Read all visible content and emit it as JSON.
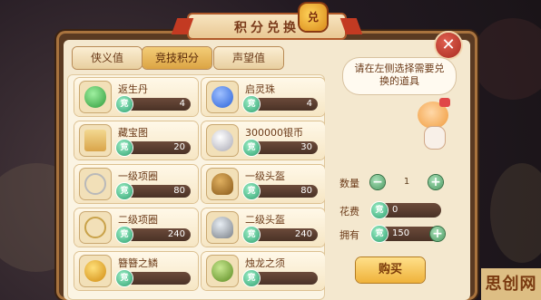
{
  "title": "积分兑换",
  "banner_badge": "兑",
  "close_glyph": "✕",
  "tabs": [
    {
      "label": "侠义值",
      "active": false
    },
    {
      "label": "竞技积分",
      "active": true
    },
    {
      "label": "声望值",
      "active": false
    }
  ],
  "currency_glyph": "竞",
  "items": [
    {
      "name": "返生丹",
      "price": "4",
      "icon": "pill-icon",
      "color": "#2e9a3a"
    },
    {
      "name": "启灵珠",
      "price": "4",
      "icon": "blue-orb-icon",
      "color": "#2a62d8"
    },
    {
      "name": "藏宝图",
      "price": "20",
      "icon": "treasure-map-icon",
      "color": "#d9a54a"
    },
    {
      "name": "300000银币",
      "price": "30",
      "icon": "silver-coins-icon",
      "color": "#c8c8d0"
    },
    {
      "name": "一级项圈",
      "price": "80",
      "icon": "necklace-icon",
      "color": "#b9b9b9"
    },
    {
      "name": "一级头盔",
      "price": "80",
      "icon": "helmet-icon",
      "color": "#b07a2a"
    },
    {
      "name": "二级项圈",
      "price": "240",
      "icon": "necklace-icon",
      "color": "#c9a24a"
    },
    {
      "name": "二级头盔",
      "price": "240",
      "icon": "helmet-icon",
      "color": "#9aa0a8"
    },
    {
      "name": "簪簪之鳞",
      "price": "",
      "icon": "scale-icon",
      "color": "#e0a030"
    },
    {
      "name": "烛龙之须",
      "price": "",
      "icon": "whisker-icon",
      "color": "#7a9a3a"
    }
  ],
  "hint": "请在左侧选择需要兑换的道具",
  "quantity": {
    "label": "数量",
    "value": "1",
    "minus": "−",
    "plus": "+"
  },
  "cost": {
    "label": "花费",
    "value": "0"
  },
  "owned": {
    "label": "拥有",
    "value": "150"
  },
  "buy_label": "购买",
  "watermark": "思创网"
}
